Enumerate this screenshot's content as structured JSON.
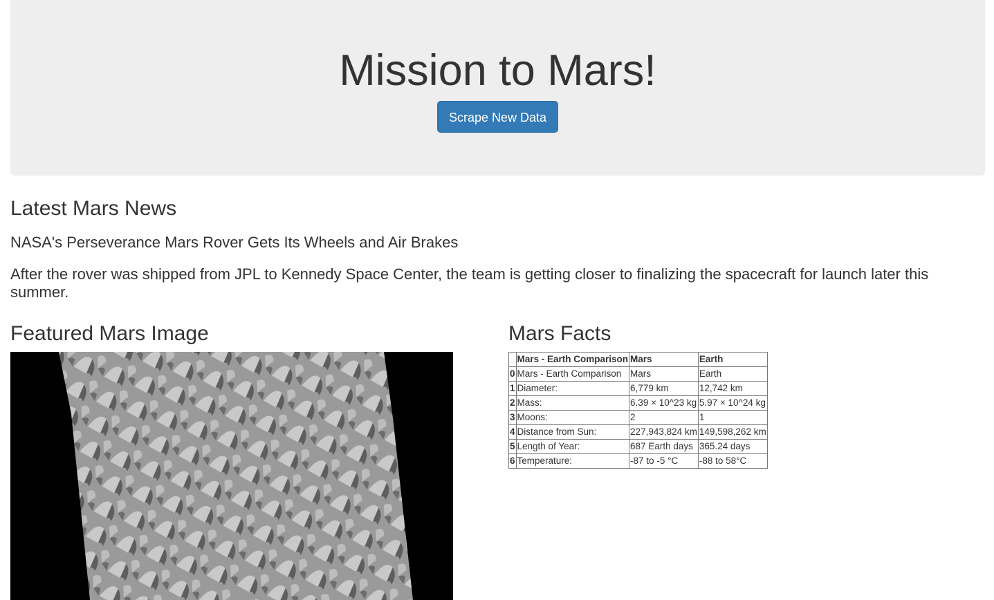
{
  "header": {
    "title": "Mission to Mars!",
    "scrape_button_label": "Scrape New Data"
  },
  "news": {
    "heading": "Latest Mars News",
    "title": "NASA's Perseverance Mars Rover Gets Its Wheels and Air Brakes",
    "teaser": "After the rover was shipped from JPL to Kennedy Space Center, the team is getting closer to finalizing the spacecraft for launch later this summer."
  },
  "featured": {
    "heading": "Featured Mars Image"
  },
  "facts": {
    "heading": "Mars Facts",
    "columns": [
      "",
      "Mars - Earth Comparison",
      "Mars",
      "Earth"
    ],
    "rows": [
      [
        "0",
        "Mars - Earth Comparison",
        "Mars",
        "Earth"
      ],
      [
        "1",
        "Diameter:",
        "6,779 km",
        "12,742 km"
      ],
      [
        "2",
        "Mass:",
        "6.39 × 10^23 kg",
        "5.97 × 10^24 kg"
      ],
      [
        "3",
        "Moons:",
        "2",
        "1"
      ],
      [
        "4",
        "Distance from Sun:",
        "227,943,824 km",
        "149,598,262 km"
      ],
      [
        "5",
        "Length of Year:",
        "687 Earth days",
        "365.24 days"
      ],
      [
        "6",
        "Temperature:",
        "-87 to -5 °C",
        "-88 to 58°C"
      ]
    ]
  },
  "colors": {
    "jumbotron_bg": "#eeeeee",
    "button_bg": "#337ab7",
    "text": "#333333"
  }
}
